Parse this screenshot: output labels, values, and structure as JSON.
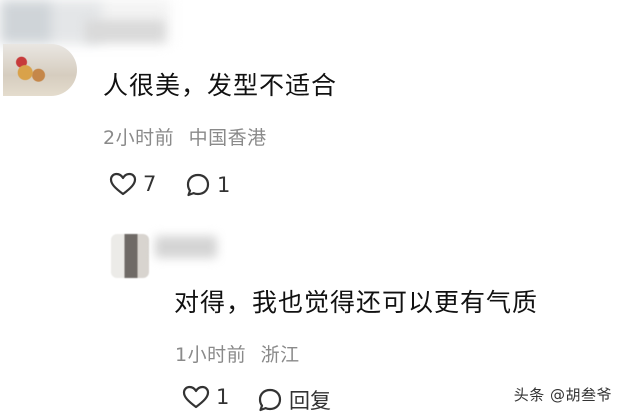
{
  "comment": {
    "text": "人很美，发型不适合",
    "time": "2小时前",
    "location": "中国香港",
    "like_count": "7",
    "reply_count": "1"
  },
  "reply": {
    "text": "对得，我也觉得还可以更有气质",
    "time": "1小时前",
    "location": "浙江",
    "like_count": "1",
    "reply_label": "回复"
  },
  "watermark": {
    "text": "头条 @胡叁爷"
  },
  "icons": {
    "like": "heart-outline-icon",
    "comment": "speech-bubble-icon"
  }
}
